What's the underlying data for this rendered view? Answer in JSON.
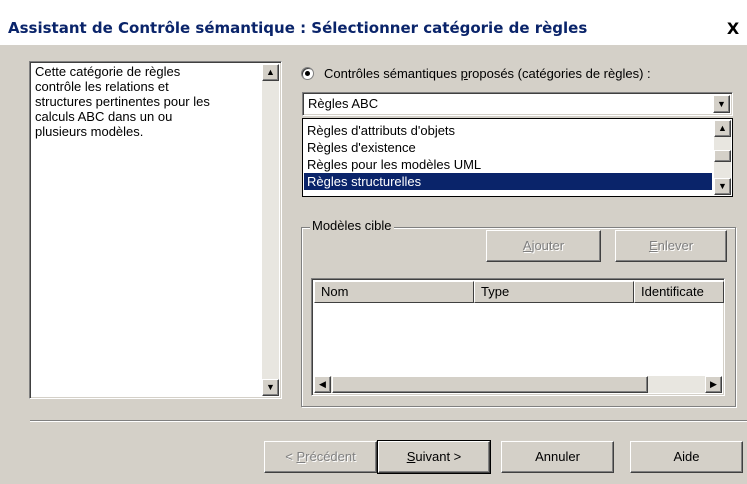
{
  "window": {
    "title": "Assistant de Contrôle sémantique : Sélectionner catégorie de règles",
    "close_glyph": "X"
  },
  "description": {
    "text": "Cette catégorie de règles\ncontrôle les relations et\nstructures pertinentes pour les\ncalculs ABC dans un ou\nplusieurs modèles."
  },
  "proposed": {
    "label_pre": "Contrôles sémantiques ",
    "label_underlined": "p",
    "label_post": "roposés (catégories de règles) :",
    "selected_value": "Règles ABC",
    "options": [
      "Règles d'attributs d'objets",
      "Règles d'existence",
      "Règles pour les modèles UML",
      "Règles structurelles"
    ],
    "highlighted_index": 3
  },
  "target_models": {
    "group_label": "Modèles cible",
    "add": {
      "u": "A",
      "rest": "jouter"
    },
    "remove": {
      "u": "E",
      "rest": "nlever"
    },
    "columns": [
      "Nom",
      "Type",
      "Identificate"
    ]
  },
  "footer": {
    "prev": {
      "pre": "< ",
      "u": "P",
      "rest": "récédent"
    },
    "next": {
      "u": "S",
      "rest": "uivant >"
    },
    "cancel": "Annuler",
    "help": "Aide"
  },
  "icons": {
    "scroll_up": "▲",
    "scroll_down": "▼",
    "scroll_left": "◀",
    "scroll_right": "▶",
    "dropdown": "▼"
  }
}
